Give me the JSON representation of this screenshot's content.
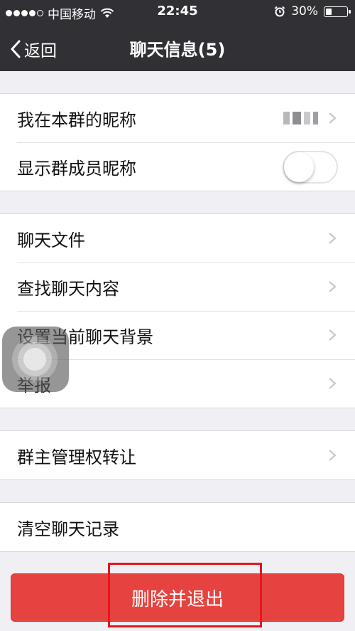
{
  "status_bar": {
    "carrier": "中国移动",
    "time": "22:45",
    "battery": "30%"
  },
  "nav": {
    "back_label": "返回",
    "title": "聊天信息(5)"
  },
  "group1": {
    "nickname_label": "我在本群的昵称",
    "show_nickname_label": "显示群成员昵称",
    "show_nickname_on": false
  },
  "group2": {
    "items": [
      {
        "label": "聊天文件"
      },
      {
        "label": "查找聊天内容"
      },
      {
        "label": "设置当前聊天背景"
      },
      {
        "label": "举报"
      }
    ]
  },
  "group3": {
    "transfer_label": "群主管理权转让"
  },
  "group4": {
    "clear_label": "清空聊天记录"
  },
  "delete_button": {
    "label": "删除并退出"
  },
  "colors": {
    "nav_bg": "#303035",
    "page_bg": "#efeff4",
    "danger": "#e64340",
    "highlight_box": "#e8141b"
  }
}
